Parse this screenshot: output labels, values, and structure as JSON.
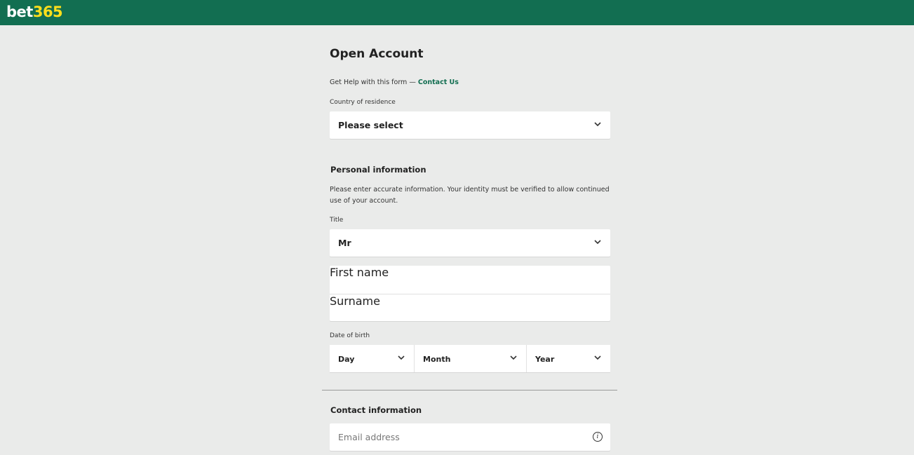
{
  "header": {
    "logo_part1": "bet",
    "logo_part2": "365",
    "brand_color": "#126e51",
    "accent_color": "#ffdf1b"
  },
  "form": {
    "title": "Open Account",
    "help_text": "Get Help with this form — ",
    "help_link": "Contact Us",
    "country": {
      "label": "Country of residence",
      "value": "Please select"
    },
    "personal": {
      "heading": "Personal information",
      "description": "Please enter accurate information. Your identity must be verified to allow continued use of your account.",
      "title_label": "Title",
      "title_value": "Mr",
      "first_name_placeholder": "First name",
      "surname_placeholder": "Surname",
      "dob_label": "Date of birth",
      "dob_day": "Day",
      "dob_month": "Month",
      "dob_year": "Year"
    },
    "contact": {
      "heading": "Contact information",
      "email_placeholder": "Email address",
      "info_icon": "i"
    }
  }
}
